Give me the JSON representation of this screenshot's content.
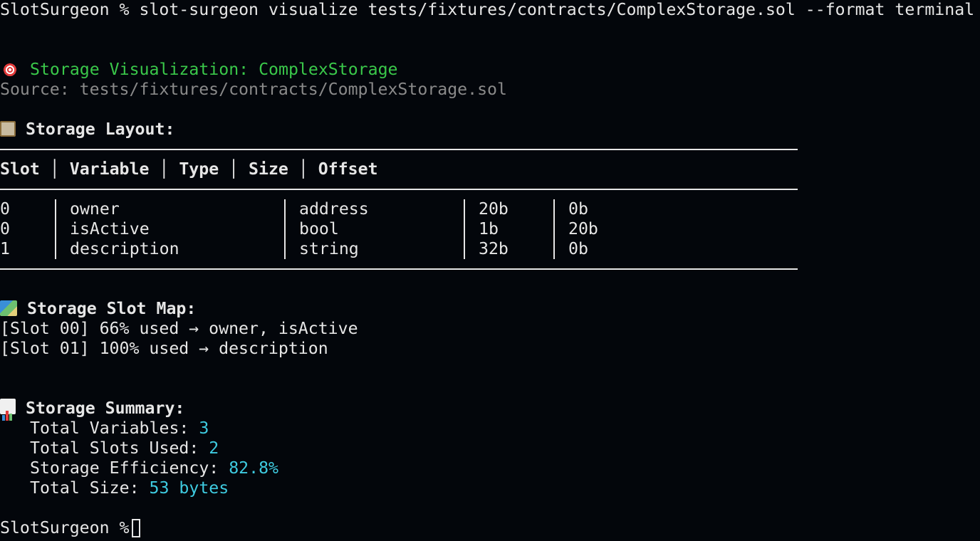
{
  "prompt": {
    "host": "SlotSurgeon",
    "symbol": "%",
    "command": "slot-surgeon visualize tests/fixtures/contracts/ComplexStorage.sol --format terminal"
  },
  "header": {
    "title": "Storage Visualization: ComplexStorage",
    "source": "Source: tests/fixtures/contracts/ComplexStorage.sol"
  },
  "layout": {
    "heading": "Storage Layout:",
    "columns": [
      "Slot",
      "Variable",
      "Type",
      "Size",
      "Offset"
    ],
    "rows": [
      {
        "slot": "0",
        "variable": "owner",
        "type": "address",
        "size": "20b",
        "offset": "0b"
      },
      {
        "slot": "0",
        "variable": "isActive",
        "type": "bool",
        "size": "1b",
        "offset": "20b"
      },
      {
        "slot": "1",
        "variable": "description",
        "type": "string",
        "size": "32b",
        "offset": "0b"
      }
    ]
  },
  "slot_map": {
    "heading": "Storage Slot Map:",
    "lines": [
      "[Slot 00] 66% used → owner, isActive",
      "[Slot 01] 100% used → description"
    ]
  },
  "summary": {
    "heading": "Storage Summary:",
    "items": [
      {
        "label": "Total Variables: ",
        "value": "3"
      },
      {
        "label": "Total Slots Used: ",
        "value": "2"
      },
      {
        "label": "Storage Efficiency: ",
        "value": "82.8%"
      },
      {
        "label": "Total Size: ",
        "value": "53 bytes"
      }
    ]
  },
  "final_prompt": "SlotSurgeon %",
  "colors": {
    "background": "#03060b",
    "text": "#e6e6e6",
    "title": "#3ac84a",
    "source": "#8a8a8a",
    "value": "#3ecbe0"
  },
  "icons": {
    "title": "direct-hit-icon",
    "layout": "clipboard-icon",
    "slot_map": "world-map-icon",
    "summary": "bar-chart-icon"
  }
}
